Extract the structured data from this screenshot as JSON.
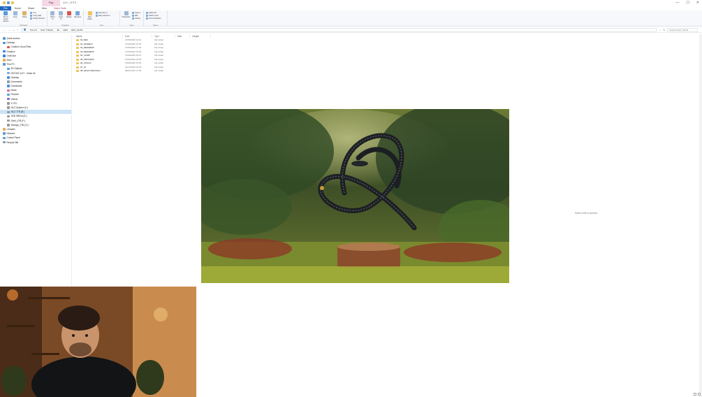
{
  "titlebar": {
    "play_label": "Play",
    "title": "0027_SHTR",
    "controls": {
      "minimize": "—",
      "maximize": "☐",
      "close": "✕"
    }
  },
  "tabs": [
    "File",
    "Home",
    "Share",
    "View",
    "Video Tools"
  ],
  "ribbon": {
    "clipboard": {
      "pin": "Pin to Quick access",
      "copy": "Copy",
      "paste": "Paste",
      "cut": "Cut",
      "copy_path": "Copy path",
      "paste_shortcut": "Paste shortcut",
      "label": "Clipboard"
    },
    "organize": {
      "move_to": "Move to",
      "copy_to": "Copy to",
      "delete": "Delete",
      "rename": "Rename",
      "label": "Organize"
    },
    "new": {
      "new_folder": "New folder",
      "new_item": "New item ▾",
      "easy_access": "Easy access ▾",
      "label": "New"
    },
    "open": {
      "properties": "Properties",
      "open": "Open ▾",
      "edit": "Edit",
      "history": "History",
      "label": "Open"
    },
    "select": {
      "select_all": "Select all",
      "select_none": "Select none",
      "invert": "Invert selection",
      "label": "Select"
    }
  },
  "address": {
    "crumbs": [
      "This PC",
      "SILZ 7TB (B:)",
      "3D",
      "2020",
      "0027_SHTR"
    ],
    "search_placeholder": "Search 0027_SHTR"
  },
  "nav": [
    {
      "label": "Quick access",
      "color": "#5b9bd5",
      "indent": 0
    },
    {
      "label": "Desktop",
      "color": "#4a90d9",
      "indent": 0
    },
    {
      "label": "Creative Cloud Files",
      "color": "#d9534f",
      "indent": 1
    },
    {
      "label": "Dropbox",
      "color": "#2f80ed",
      "indent": 0
    },
    {
      "label": "OneDrive",
      "color": "#2f80ed",
      "indent": 0
    },
    {
      "label": "Marc",
      "color": "#e0b050",
      "indent": 0
    },
    {
      "label": "This PC",
      "color": "#5b9bd5",
      "indent": 0
    },
    {
      "label": "3D Objects",
      "color": "#5b9bd5",
      "indent": 1
    },
    {
      "label": "DELTAS 1127 - Vesta Int",
      "color": "#7aa6d8",
      "indent": 1
    },
    {
      "label": "Desktop",
      "color": "#4a90d9",
      "indent": 1
    },
    {
      "label": "Documents",
      "color": "#8a9bb0",
      "indent": 1
    },
    {
      "label": "Downloads",
      "color": "#4a90d9",
      "indent": 1
    },
    {
      "label": "Music",
      "color": "#d36b9c",
      "indent": 1
    },
    {
      "label": "Pictures",
      "color": "#5b9bd5",
      "indent": 1
    },
    {
      "label": "Videos",
      "color": "#7a6bd3",
      "indent": 1
    },
    {
      "label": "X-791",
      "color": "#999999",
      "indent": 1
    },
    {
      "label": "SILZ System (C:)",
      "color": "#999999",
      "indent": 1
    },
    {
      "label": "SILZ 7TB (B:)",
      "color": "#999999",
      "indent": 1,
      "selected": true
    },
    {
      "label": "SSD 990Gb (E:)",
      "color": "#999999",
      "indent": 1
    },
    {
      "label": "Shell_4TB (F:)",
      "color": "#999999",
      "indent": 1
    },
    {
      "label": "Storage_2TB (G:)",
      "color": "#999999",
      "indent": 1
    },
    {
      "label": "Libraries",
      "color": "#e0b050",
      "indent": 0
    },
    {
      "label": "Network",
      "color": "#5b9bd5",
      "indent": 0
    },
    {
      "label": "Control Panel",
      "color": "#5b9bd5",
      "indent": 0
    },
    {
      "label": "Recycle Bin",
      "color": "#8a9bb0",
      "indent": 0
    }
  ],
  "columns": {
    "name": "Name",
    "date": "Date",
    "type": "Type",
    "size": "Size",
    "length": "Length"
  },
  "files": [
    {
      "name": "00_REF",
      "date": "27/06/2020 19:31",
      "type": "File folder"
    },
    {
      "name": "01_MODELS",
      "date": "27/06/2020 15:54",
      "type": "File folder"
    },
    {
      "name": "02_RENDERS",
      "date": "27/06/2020 17:04",
      "type": "File folder"
    },
    {
      "name": "03_RENDERS",
      "date": "27/06/2020 19:04",
      "type": "File folder"
    },
    {
      "name": "04_COMP",
      "date": "27/06/2020 18:14",
      "type": "File folder"
    },
    {
      "name": "05_PROCESS",
      "date": "07/06/2020 15:26",
      "type": "File folder"
    },
    {
      "name": "06_FINALS",
      "date": "10/06/2020 15:26",
      "type": "File folder"
    },
    {
      "name": "07_IG",
      "date": "01/12/2020 10:26",
      "type": "File folder"
    },
    {
      "name": "08_WALKTHROUGH",
      "date": "08/01/2021 17:09",
      "type": "File folder"
    }
  ],
  "preview": {
    "empty_message": "Select a file to preview."
  },
  "colors": {
    "accent": "#1f67c2",
    "folder": "#f2c55c",
    "selected": "#cce4f7"
  }
}
